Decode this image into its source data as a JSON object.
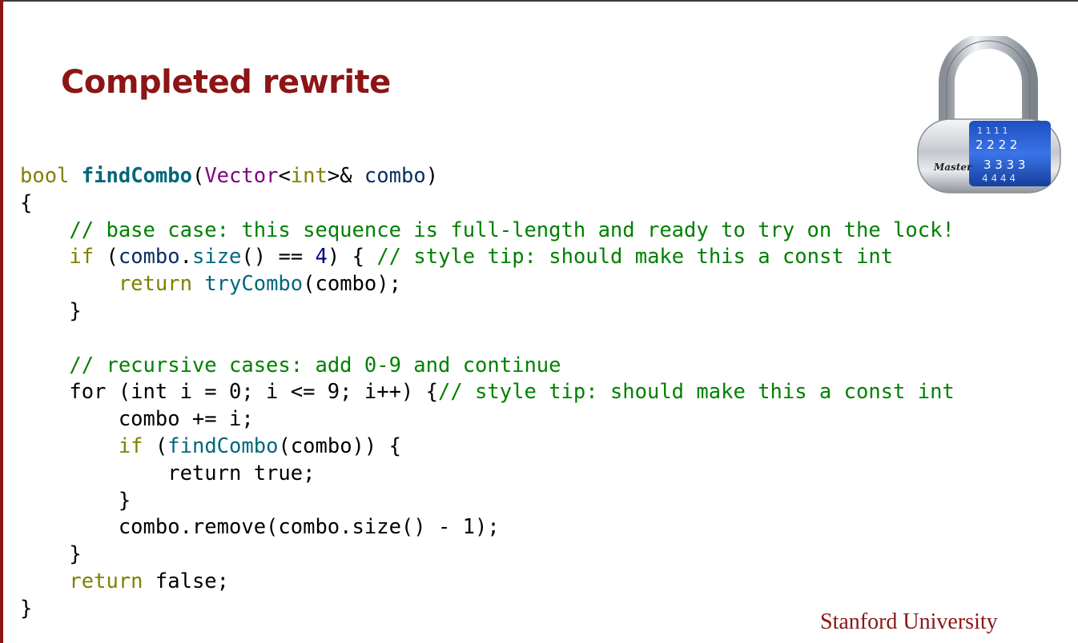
{
  "slide": {
    "title": "Completed rewrite",
    "footer": "Stanford University"
  },
  "lock_image": {
    "icon": "combination-padlock-icon",
    "brand": "Master",
    "dial_digits": [
      "1111",
      "2222",
      "3333",
      "4444"
    ],
    "dial_color": "#2255c4"
  },
  "colors": {
    "title": "#8c1515",
    "keyword": "#808000",
    "comment": "#008000",
    "function": "#00677c",
    "type": "#800080",
    "variable": "#092e64",
    "number": "#000080"
  },
  "code": {
    "lines": [
      [
        {
          "t": "bool",
          "c": "kw"
        },
        {
          "t": " "
        },
        {
          "t": "findCombo",
          "c": "fn-def"
        },
        {
          "t": "("
        },
        {
          "t": "Vector",
          "c": "ty"
        },
        {
          "t": "<"
        },
        {
          "t": "int",
          "c": "kw"
        },
        {
          "t": ">& "
        },
        {
          "t": "combo",
          "c": "var"
        },
        {
          "t": ")"
        }
      ],
      [
        {
          "t": "{"
        }
      ],
      [
        {
          "t": "    "
        },
        {
          "t": "// base case: this sequence is full-length and ready to try on the lock!",
          "c": "cm"
        }
      ],
      [
        {
          "t": "    "
        },
        {
          "t": "if",
          "c": "kw"
        },
        {
          "t": " ("
        },
        {
          "t": "combo",
          "c": "var"
        },
        {
          "t": "."
        },
        {
          "t": "size",
          "c": "fn"
        },
        {
          "t": "() == "
        },
        {
          "t": "4",
          "c": "num"
        },
        {
          "t": ") { "
        },
        {
          "t": "// style tip: should make this a const int",
          "c": "cm"
        }
      ],
      [
        {
          "t": "        "
        },
        {
          "t": "return",
          "c": "kw"
        },
        {
          "t": " "
        },
        {
          "t": "tryCombo",
          "c": "fn"
        },
        {
          "t": "(combo);"
        }
      ],
      [
        {
          "t": "    }"
        }
      ],
      [
        {
          "t": ""
        }
      ],
      [
        {
          "t": "    "
        },
        {
          "t": "// recursive cases: add 0-9 and continue",
          "c": "cm"
        }
      ],
      [
        {
          "t": "    for (int i = 0; i <= 9; i++) {"
        },
        {
          "t": "// style tip: should make this a const int",
          "c": "cm"
        }
      ],
      [
        {
          "t": "        combo += i;"
        }
      ],
      [
        {
          "t": "        "
        },
        {
          "t": "if",
          "c": "kw"
        },
        {
          "t": " ("
        },
        {
          "t": "findCombo",
          "c": "fn"
        },
        {
          "t": "(combo)) {"
        }
      ],
      [
        {
          "t": "            return true;"
        }
      ],
      [
        {
          "t": "        }"
        }
      ],
      [
        {
          "t": "        combo.remove(combo.size() - 1);"
        }
      ],
      [
        {
          "t": "    }"
        }
      ],
      [
        {
          "t": "    "
        },
        {
          "t": "return",
          "c": "kw"
        },
        {
          "t": " false;"
        }
      ],
      [
        {
          "t": "}"
        }
      ]
    ]
  }
}
